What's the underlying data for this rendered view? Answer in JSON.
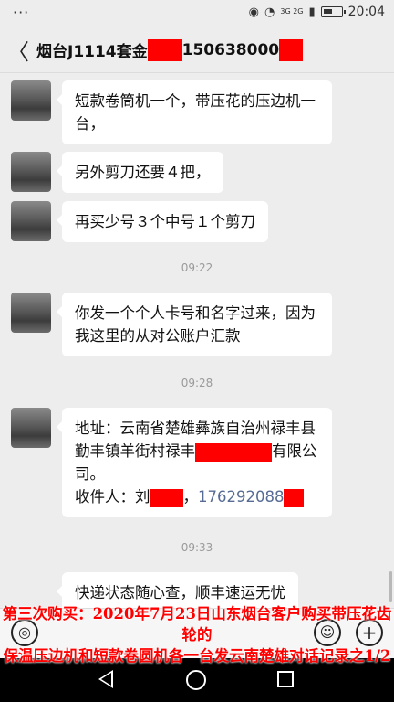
{
  "status_bar": {
    "dots": "···",
    "network": "3G 2G",
    "time": "20:04"
  },
  "header": {
    "back": "〈",
    "title_part1": "烟台J1114套金",
    "title_part2": "150638000"
  },
  "messages": [
    {
      "text": "短款卷筒机一个，带压花的压边机一台，"
    },
    {
      "text": "另外剪刀还要４把，"
    },
    {
      "text": "再买少号３个中号１个剪刀"
    },
    {
      "text": "你发一个个人卡号和名字过来，因为我这里的从对公账户汇款"
    },
    {
      "addr_a": "地址：云南省楚雄彝族自治州禄丰县勤丰镇羊街村禄丰",
      "addr_b": "有限公司。",
      "recv_label": "收件人：刘",
      "recv_sep": "，",
      "phone": "176292088"
    },
    {
      "text": "快递状态随心查，顺丰速运无忧"
    }
  ],
  "times": [
    "09:22",
    "09:28",
    "09:33"
  ],
  "caption": {
    "line1": "第三次购买：2020年7月23日山东烟台客户购买带压花齿轮的",
    "line2": "保温压边机和短款卷圆机各一台发云南楚雄对话记录之1/2"
  },
  "inputbar": {
    "voice": "◎",
    "emoji": "☺",
    "plus": "+"
  },
  "colors": {
    "redaction": "#ff0000",
    "caption": "#ff0000",
    "link": "#576b95"
  }
}
